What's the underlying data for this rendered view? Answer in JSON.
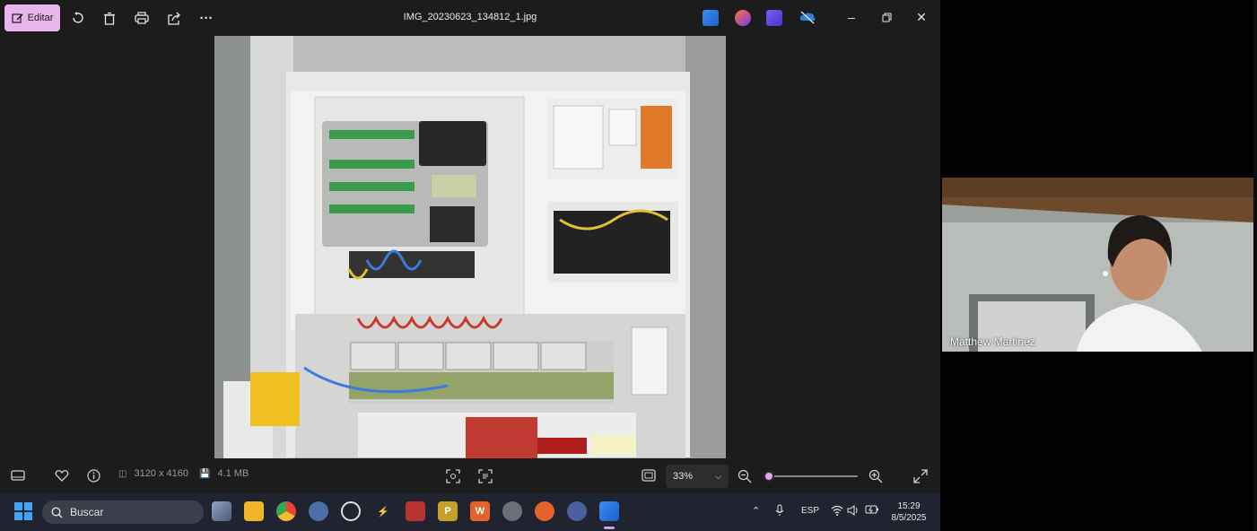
{
  "titlebar": {
    "edit_label": "Editar",
    "file_name": "IMG_20230623_134812_1.jpg",
    "icons": [
      "edit-icon",
      "rotate-icon",
      "delete-icon",
      "print-icon",
      "share-icon",
      "more-icon"
    ],
    "window_controls": [
      "minimize-icon",
      "restore-icon",
      "close-icon"
    ]
  },
  "bottombar": {
    "dimensions": "3120 x 4160",
    "file_size": "4.1 MB",
    "zoom_level": "33%",
    "zoom_slider_value": 0.05
  },
  "taskbar": {
    "search_placeholder": "Buscar",
    "language": "ESP",
    "time": "15:29",
    "date": "8/5/2025"
  },
  "video_call": {
    "participant_name": "Matthew Martinez"
  },
  "colors": {
    "edit_accent": "#e8b6ec",
    "window_bg": "#1c1c1c",
    "taskbar_bg": "#1f2430"
  }
}
